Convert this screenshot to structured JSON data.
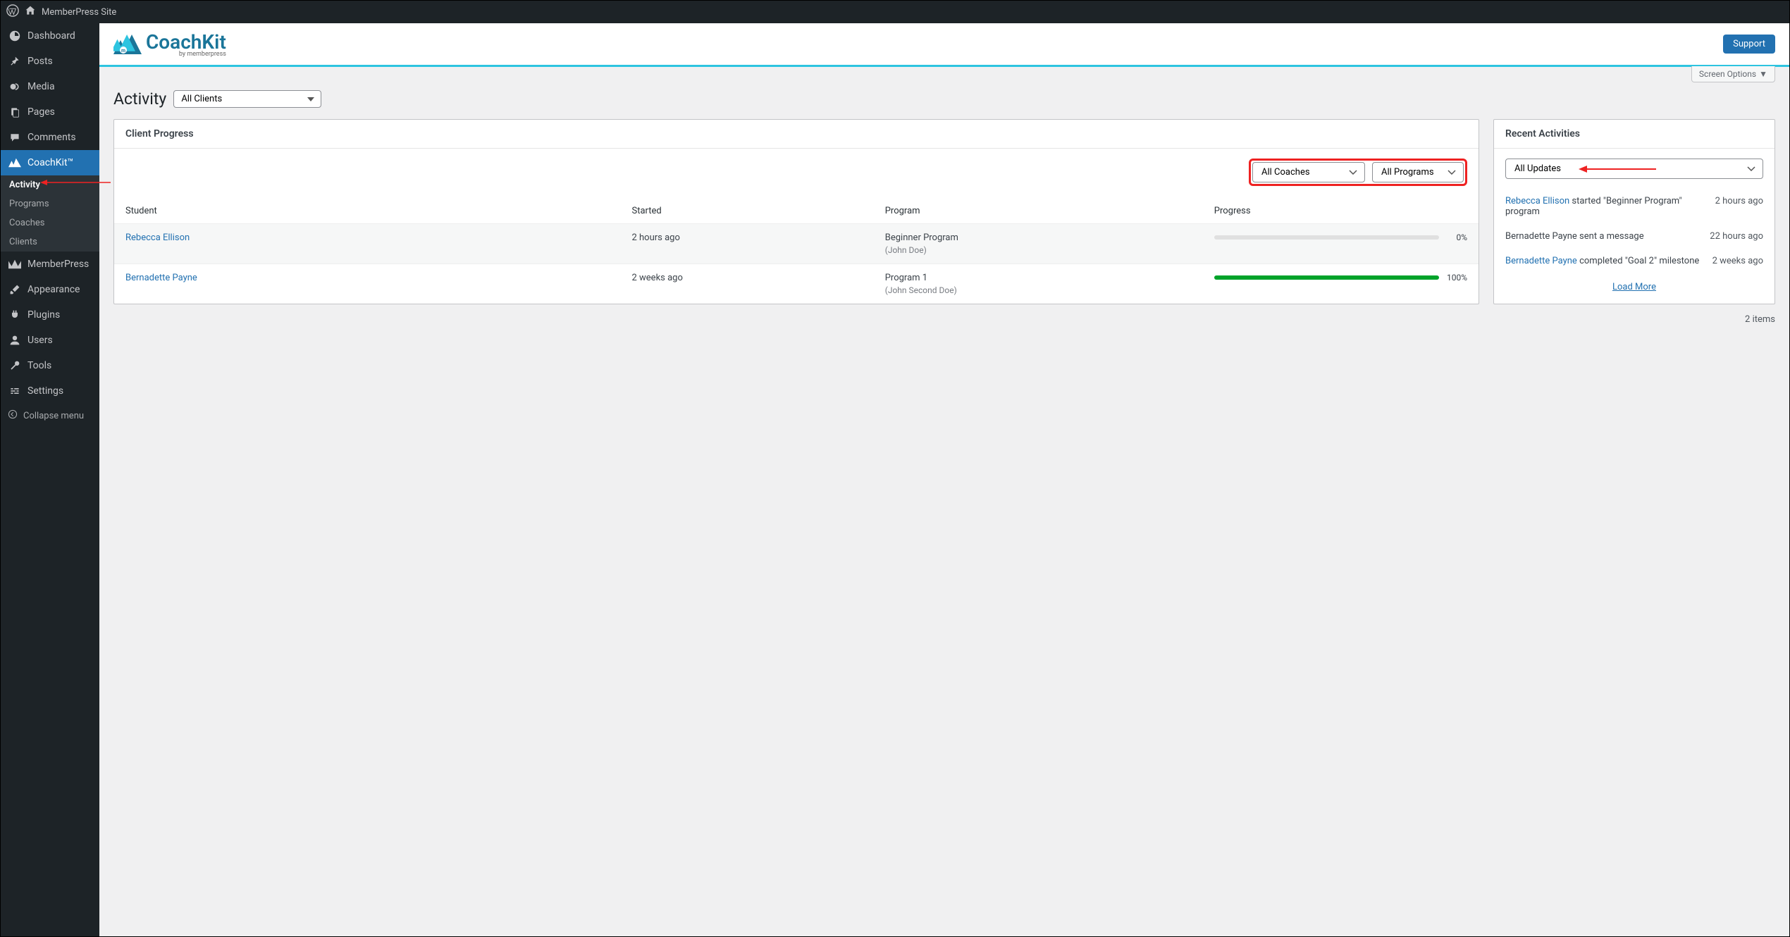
{
  "topbar": {
    "site_name": "MemberPress Site"
  },
  "sidebar": {
    "items": [
      {
        "label": "Dashboard"
      },
      {
        "label": "Posts"
      },
      {
        "label": "Media"
      },
      {
        "label": "Pages"
      },
      {
        "label": "Comments"
      },
      {
        "label": "CoachKit™"
      },
      {
        "label": "MemberPress"
      },
      {
        "label": "Appearance"
      },
      {
        "label": "Plugins"
      },
      {
        "label": "Users"
      },
      {
        "label": "Tools"
      },
      {
        "label": "Settings"
      }
    ],
    "sub": [
      {
        "label": "Activity"
      },
      {
        "label": "Programs"
      },
      {
        "label": "Coaches"
      },
      {
        "label": "Clients"
      }
    ],
    "collapse": "Collapse menu"
  },
  "header": {
    "logo_main": "CoachKit",
    "logo_sub": "by memberpress",
    "support": "Support",
    "screen_options": "Screen Options"
  },
  "page": {
    "title": "Activity",
    "clients_select": "All Clients"
  },
  "client_progress": {
    "title": "Client Progress",
    "coaches_select": "All Coaches",
    "programs_select": "All Programs",
    "columns": {
      "student": "Student",
      "started": "Started",
      "program": "Program",
      "progress": "Progress"
    },
    "rows": [
      {
        "student": "Rebecca Ellison",
        "started": "2 hours ago",
        "program": "Beginner Program",
        "coach": "(John Doe)",
        "pct": "0%",
        "pct_val": 0
      },
      {
        "student": "Bernadette Payne",
        "started": "2 weeks ago",
        "program": "Program 1",
        "coach": "(John Second Doe)",
        "pct": "100%",
        "pct_val": 100
      }
    ],
    "count": "2 items"
  },
  "recent": {
    "title": "Recent Activities",
    "updates_select": "All Updates",
    "items": [
      {
        "link": "Rebecca Ellison",
        "text": " started \"Beginner Program\" program",
        "time": "2 hours ago"
      },
      {
        "link": "",
        "text": "Bernadette Payne sent a message",
        "time": "22 hours ago"
      },
      {
        "link": "Bernadette Payne",
        "text": " completed \"Goal 2\" milestone",
        "time": "2 weeks ago"
      }
    ],
    "load_more": "Load More"
  }
}
